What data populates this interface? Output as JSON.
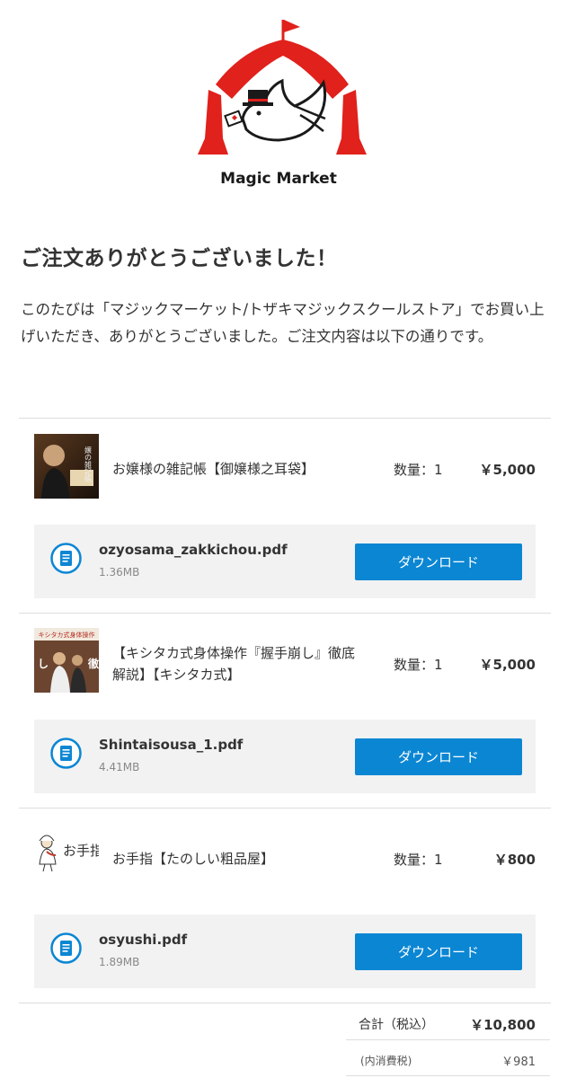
{
  "brand": {
    "name": "Magic Market",
    "red": "#e0211c",
    "dark": "#1a1a1a"
  },
  "heading": "ご注文ありがとうございました！",
  "intro": "このたびは「マジックマーケット/トザキマジックスクールストア」でお買い上げいただき、ありがとうございました。ご注文内容は以下の通りです。",
  "accent": "#0b86d3",
  "items": [
    {
      "name": "お嬢様の雑記帳【御嬢様之耳袋】",
      "quantity": "数量：1",
      "price": "￥5,000",
      "thumb_text": "嬢の雑記帳",
      "file": {
        "name": "ozyosama_zakkichou.pdf",
        "size": "1.36MB",
        "button": "ダウンロード",
        "icon": "document-icon"
      }
    },
    {
      "name": "【キシタカ式身体操作『握手崩し』徹底解説】【キシタカ式】",
      "quantity": "数量：1",
      "price": "￥5,000",
      "thumb_text": "キシタカ式身体操作",
      "file": {
        "name": "Shintaisousa_1.pdf",
        "size": "4.41MB",
        "button": "ダウンロード",
        "icon": "document-icon"
      }
    },
    {
      "name": "お手指【たのしい粗品屋】",
      "quantity": "数量：1",
      "price": "￥800",
      "thumb_text": "お手指",
      "file": {
        "name": "osyushi.pdf",
        "size": "1.89MB",
        "button": "ダウンロード",
        "icon": "document-icon"
      }
    }
  ],
  "totals": {
    "total_label": "合計（税込）",
    "total_value": "￥10,800",
    "tax_label": "(内消費税)",
    "tax_value": "￥981"
  }
}
